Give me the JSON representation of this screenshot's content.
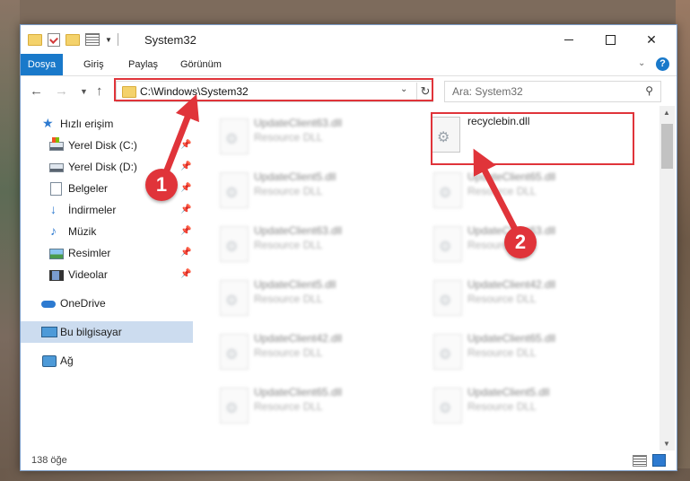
{
  "window": {
    "title": "System32",
    "controls": {
      "minimize": "",
      "maximize": "",
      "close": "✕"
    }
  },
  "ribbon": {
    "tabs": [
      "Dosya",
      "Giriş",
      "Paylaş",
      "Görünüm"
    ],
    "help": "?"
  },
  "address_bar": {
    "path": "C:\\Windows\\System32",
    "search_placeholder": "Ara: System32"
  },
  "sidebar": {
    "quick_access": "Hızlı erişim",
    "items": [
      {
        "label": "Yerel Disk (C:)",
        "pinned": true
      },
      {
        "label": "Yerel Disk (D:)",
        "pinned": true
      },
      {
        "label": "Belgeler",
        "pinned": true
      },
      {
        "label": "İndirmeler",
        "pinned": true
      },
      {
        "label": "Müzik",
        "pinned": true
      },
      {
        "label": "Resimler",
        "pinned": true
      },
      {
        "label": "Videolar",
        "pinned": true
      }
    ],
    "onedrive": "OneDrive",
    "this_pc": "Bu bilgisayar",
    "network": "Ağ"
  },
  "files": {
    "left_column": [
      {
        "name": "UpdateClient63.dll",
        "type": "Resource DLL"
      },
      {
        "name": "UpdateClient5.dll",
        "type": "Resource DLL"
      },
      {
        "name": "UpdateClient63.dll",
        "type": "Resource DLL"
      },
      {
        "name": "UpdateClient5.dll",
        "type": "Resource DLL"
      },
      {
        "name": "UpdateClient42.dll",
        "type": "Resource DLL"
      },
      {
        "name": "UpdateClient65.dll",
        "type": "Resource DLL"
      }
    ],
    "right_column": [
      {
        "name": "recyclebin.dll",
        "type": ""
      },
      {
        "name": "UpdateClient65.dll",
        "type": "Resource DLL"
      },
      {
        "name": "UpdateClient63.dll",
        "type": "Resource DLL"
      },
      {
        "name": "UpdateClient42.dll",
        "type": "Resource DLL"
      },
      {
        "name": "UpdateClient65.dll",
        "type": "Resource DLL"
      },
      {
        "name": "UpdateClient5.dll",
        "type": "Resource DLL"
      }
    ]
  },
  "status": {
    "item_count": "138 öğe"
  },
  "annotations": {
    "step1": "1",
    "step2": "2",
    "color": "#e0343a"
  }
}
